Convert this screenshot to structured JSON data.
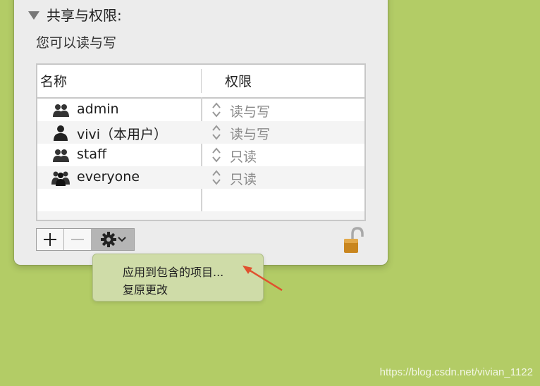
{
  "sharing": {
    "section_title": "共享与权限:",
    "access_text": "您可以读与写",
    "columns": {
      "name": "名称",
      "privilege": "权限"
    },
    "rows": [
      {
        "name": "admin",
        "privilege": "读与写",
        "icon": "group-icon"
      },
      {
        "name": "vivi（本用户）",
        "privilege": "读与写",
        "icon": "user-icon"
      },
      {
        "name": "staff",
        "privilege": "只读",
        "icon": "group-icon"
      },
      {
        "name": "everyone",
        "privilege": "只读",
        "icon": "everyone-icon"
      }
    ]
  },
  "toolbar": {
    "add": "+",
    "remove": "—"
  },
  "context_menu": {
    "items": [
      "应用到包含的项目...",
      "复原更改"
    ]
  },
  "watermark": "https://blog.csdn.net/vivian_1122",
  "colors": {
    "desktop": "#b3cc66",
    "menu_bg": "#cfdca8",
    "arrow": "#e0512f"
  }
}
